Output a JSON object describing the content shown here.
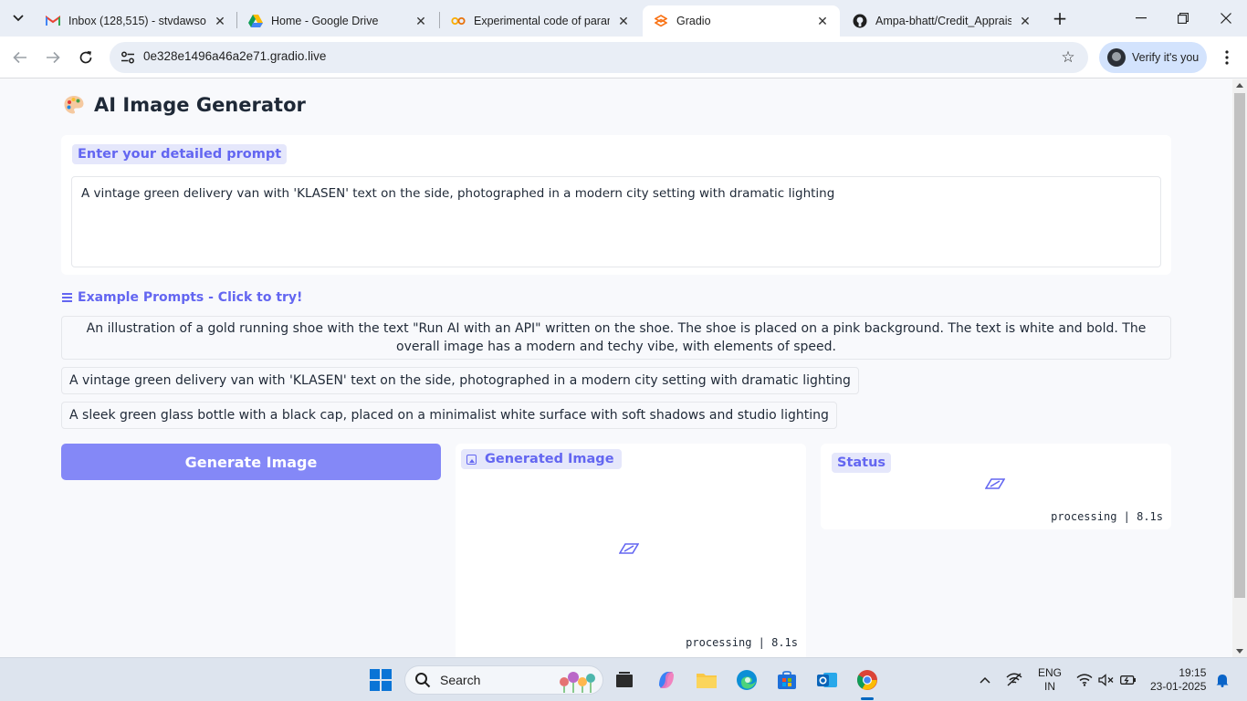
{
  "browser": {
    "tabs": [
      {
        "title": "Inbox (128,515) - stvdawson",
        "favicon": "gmail-icon",
        "active": false
      },
      {
        "title": "Home - Google Drive",
        "favicon": "google-drive-icon",
        "active": false
      },
      {
        "title": "Experimental code of param",
        "favicon": "colab-icon",
        "active": false
      },
      {
        "title": "Gradio",
        "favicon": "gradio-icon",
        "active": true
      },
      {
        "title": "Ampa-bhatt/Credit_Apprais",
        "favicon": "github-icon",
        "active": false
      }
    ],
    "url": "0e328e1496a46a2e71.gradio.live",
    "verify_label": "Verify it's you"
  },
  "app": {
    "title": "AI Image Generator",
    "prompt_label": "Enter your detailed prompt",
    "prompt_value": "A vintage green delivery van with 'KLASEN' text on the side, photographed in a modern city setting with dramatic lighting",
    "examples_heading": "Example Prompts - Click to try!",
    "examples": [
      "An illustration of a gold running shoe with the text \"Run AI with an API\" written on the shoe. The shoe is placed on a pink background. The text is white and bold. The overall image has a modern and techy vibe, with elements of speed.",
      "A vintage green delivery van with 'KLASEN' text on the side, photographed in a modern city setting with dramatic lighting",
      "A sleek green glass bottle with a black cap, placed on a minimalist white surface with soft shadows and studio lighting"
    ],
    "generate_label": "Generate Image",
    "image_label": "Generated Image",
    "image_status": "processing | 8.1s",
    "status_label": "Status",
    "status_status": "processing | 8.1s",
    "accent_color": "#6366f1",
    "button_color": "#8488f7"
  },
  "taskbar": {
    "search_placeholder": "Search",
    "language_line1": "ENG",
    "language_line2": "IN",
    "time": "19:15",
    "date": "23-01-2025"
  }
}
